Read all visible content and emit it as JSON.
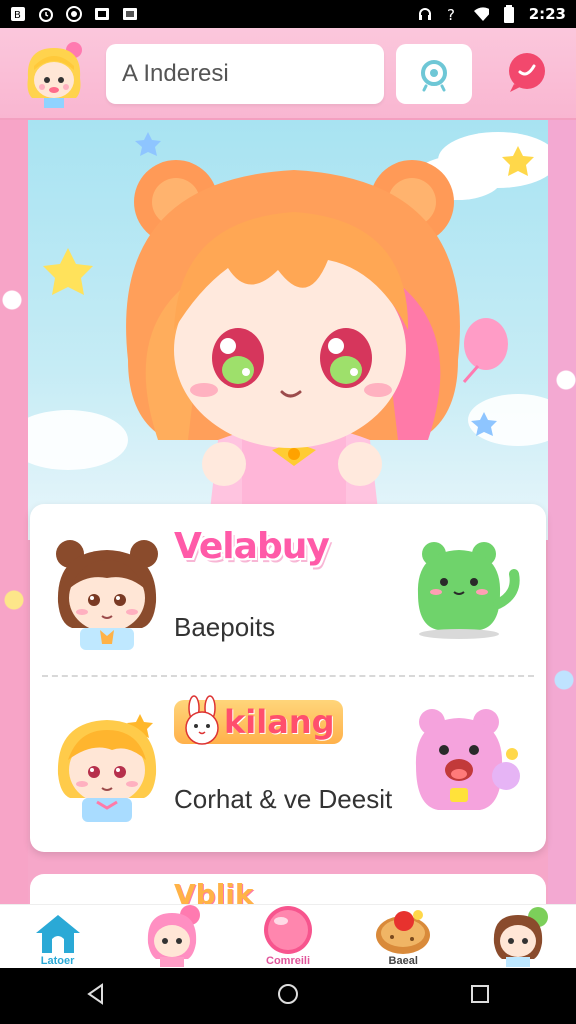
{
  "status_bar": {
    "time": "2:23",
    "left_icons": [
      "notification-icon",
      "alarm-icon",
      "circle-icon",
      "photo-icon",
      "photo-icon"
    ],
    "right_icons": [
      "headset-icon",
      "signal-question-icon",
      "wifi-icon",
      "battery-icon"
    ]
  },
  "header": {
    "search_text": "A Inderesi",
    "avatar_icon": "blonde-girl-avatar",
    "search_icon": "search-icon",
    "chat_icon": "chat-bubble-icon"
  },
  "feed": {
    "items": [
      {
        "title": "Velabuy",
        "subtitle": "Baepoits",
        "character": "brown-hair-girl",
        "mascot": "green-frog-mascot"
      },
      {
        "title": "kilang",
        "subtitle": "Corhat & ve Deesit",
        "character": "blonde-boy",
        "mascot": "pink-bear-mascot"
      }
    ],
    "next_item_title": "Vblik"
  },
  "bottom_nav": {
    "items": [
      {
        "label": "Latoer",
        "icon": "home-icon"
      },
      {
        "label": "",
        "icon": "pink-hair-character-icon"
      },
      {
        "label": "Comreili",
        "icon": "pink-ball-icon"
      },
      {
        "label": "Baeal",
        "icon": "cookie-icon"
      },
      {
        "label": "",
        "icon": "girl-character-icon"
      }
    ]
  },
  "colors": {
    "primary_pink": "#f9b6d1",
    "accent_blue": "#2aa9d6",
    "title_pink": "#ff5aa8"
  }
}
